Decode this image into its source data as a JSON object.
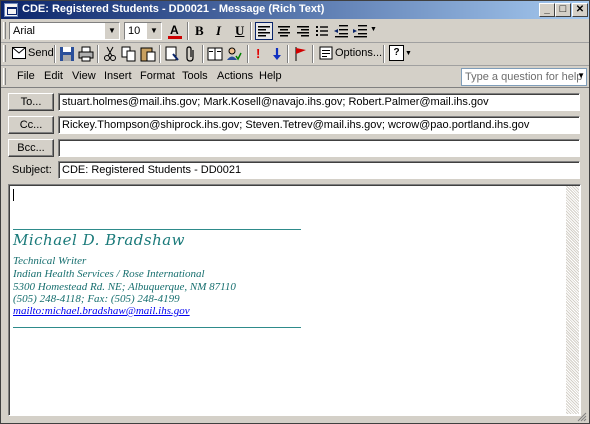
{
  "window": {
    "title": "CDE: Registered Students - DD0021 - Message (Rich Text)",
    "controls": {
      "minimize": "_",
      "maximize": "□",
      "close": "✕"
    }
  },
  "formatting_toolbar": {
    "font": "Arial",
    "size": "10",
    "bold": "B",
    "italic": "I",
    "underline": "U"
  },
  "standard_toolbar": {
    "send_label": "Send",
    "options_label": "Options...",
    "help_icon": "?"
  },
  "menu": {
    "items": [
      "File",
      "Edit",
      "View",
      "Insert",
      "Format",
      "Tools",
      "Actions",
      "Help"
    ],
    "help_placeholder": "Type a question for help"
  },
  "message": {
    "to_label": "To...",
    "cc_label": "Cc...",
    "bcc_label": "Bcc...",
    "subject_label": "Subject:",
    "to": "stuart.holmes@mail.ihs.gov; Mark.Kosell@navajo.ihs.gov; Robert.Palmer@mail.ihs.gov",
    "cc": "Rickey.Thompson@shiprock.ihs.gov; Steven.Tetrev@mail.ihs.gov; wcrow@pao.portland.ihs.gov",
    "bcc": "",
    "subject": "CDE: Registered Students - DD0021"
  },
  "signature": {
    "name": "Michael D. Bradshaw",
    "lines": [
      "Technical Writer",
      "Indian Health Services / Rose International",
      "5300 Homestead Rd. NE; Albuquerque, NM  87110",
      "(505) 248-4118; Fax: (505) 248-4199"
    ],
    "email_link": "mailto:michael.bradshaw@mail.ihs.gov"
  },
  "colors": {
    "titlebar_start": "#0a246a",
    "titlebar_end": "#a6caf0",
    "signature_teal": "#176f6f",
    "link_blue": "#0000ee"
  }
}
